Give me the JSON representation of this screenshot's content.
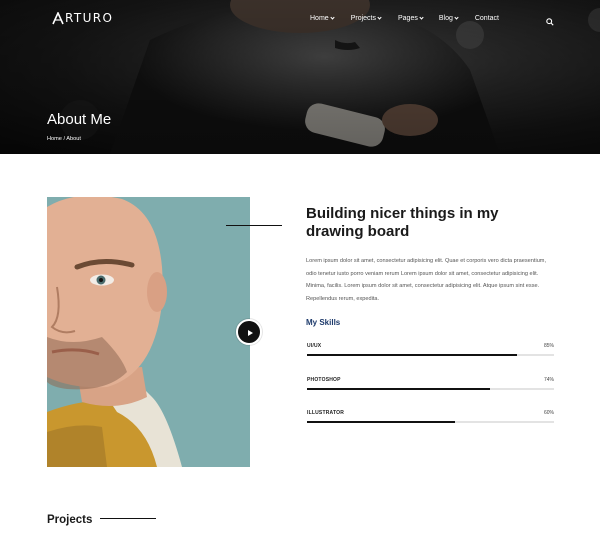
{
  "brand": {
    "logo_text": "RTURO",
    "logo_mark": "A"
  },
  "nav": {
    "items": [
      {
        "label": "Home",
        "dropdown": true
      },
      {
        "label": "Projects",
        "dropdown": true
      },
      {
        "label": "Pages",
        "dropdown": true
      },
      {
        "label": "Blog",
        "dropdown": true
      },
      {
        "label": "Contact",
        "dropdown": false
      }
    ],
    "search_icon": "search-icon"
  },
  "hero": {
    "title": "About Me",
    "breadcrumb": {
      "home": "Home",
      "separator": " / ",
      "current": "About"
    }
  },
  "about": {
    "title": "Building nicer things in my drawing board",
    "body": "Lorem ipsum dolor sit amet, consectetur adipisicing elit. Quae et corporis vero dicta praesentium, odio tenetur iusto porro veniam rerum Lorem ipsum dolor sit amet, consectetur adipisicing elit. Minima, facilis. Lorem ipsum dolor sit amet, consectetur adipisicing elit. Atque ipsum sint esse. Repellendus rerum, expedita.",
    "skills_title": "My Skills",
    "skills": [
      {
        "name": "UI/UX",
        "percent_label": "85%",
        "level": 0.85
      },
      {
        "name": "PHOTOSHOP",
        "percent_label": "74%",
        "level": 0.74
      },
      {
        "name": "ILLUSTRATOR",
        "percent_label": "60%",
        "level": 0.6
      }
    ],
    "play_icon": "play-icon"
  },
  "projects": {
    "title": "Projects"
  },
  "colors": {
    "skills_heading": "#1d3a6b",
    "bar_fill": "#111111",
    "bar_track": "#e3e3e3",
    "portrait_bg": "#7fadae"
  }
}
